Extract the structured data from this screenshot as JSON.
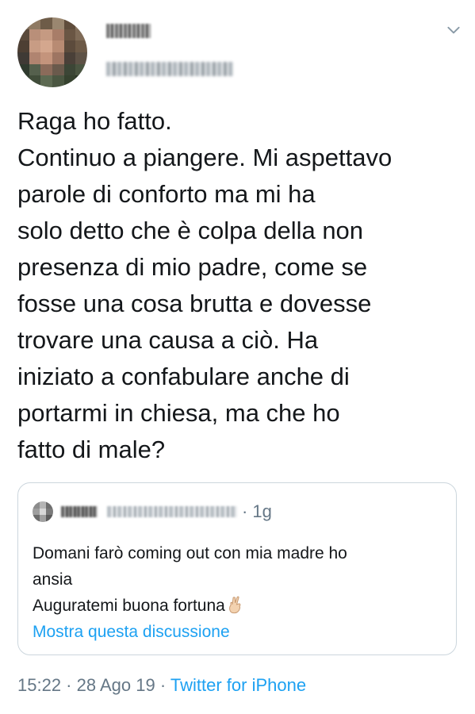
{
  "tweet": {
    "text": "Raga ho fatto.\nContinuo a piangere. Mi aspettavo\nparole di conforto ma mi ha\nsolo detto che è colpa della non\npresenza di mio padre, come se\nfosse una cosa brutta e dovesse\ntrovare una causa a ciò. Ha\niniziato a confabulare anche di\nportarmi in chiesa, ma che ho\nfatto di male?",
    "menu_icon": "chevron-down-icon"
  },
  "quoted_tweet": {
    "time": "1g",
    "separator": "·",
    "lines": [
      "Domani farò coming out con mia madre ho",
      "ansia",
      "Auguratemi buona fortuna"
    ],
    "emoji": "crossed-fingers-icon",
    "show_thread_label": "Mostra questa discussione"
  },
  "meta": {
    "time": "15:22",
    "separator": " · ",
    "date": "28 Ago 19",
    "source": "Twitter for iPhone"
  },
  "colors": {
    "link_blue": "#1da1f2",
    "secondary_text": "#657786",
    "border": "#ccd6dd",
    "primary_text": "#14171a"
  }
}
